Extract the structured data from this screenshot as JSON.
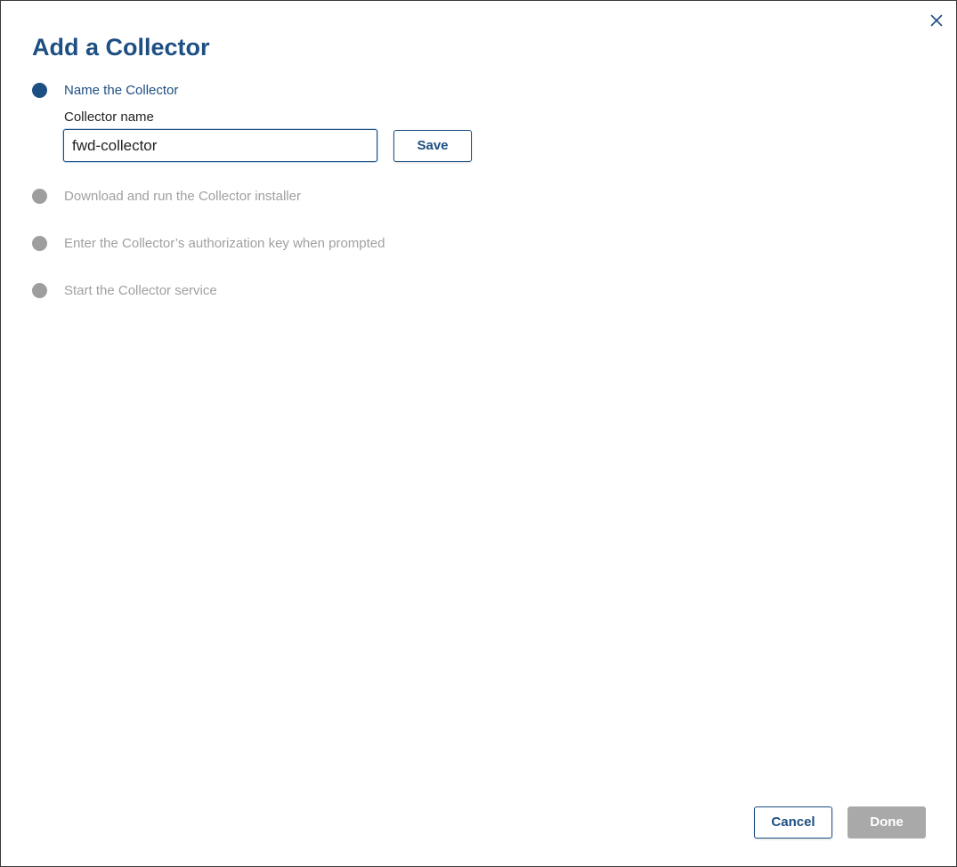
{
  "dialog": {
    "title": "Add a Collector",
    "close_icon": "close-icon"
  },
  "steps": [
    {
      "label": "Name the Collector",
      "state": "active"
    },
    {
      "label": "Download and run the Collector installer",
      "state": "inactive"
    },
    {
      "label": "Enter the Collector’s authorization key when prompted",
      "state": "inactive"
    },
    {
      "label": "Start the Collector service",
      "state": "inactive"
    }
  ],
  "name_form": {
    "label": "Collector name",
    "value": "fwd-collector",
    "save_label": "Save"
  },
  "footer": {
    "cancel_label": "Cancel",
    "done_label": "Done",
    "done_disabled": true
  },
  "colors": {
    "accent": "#1e4f82",
    "inactive": "#9e9e9e",
    "disabled_button": "#a9a9a9"
  }
}
